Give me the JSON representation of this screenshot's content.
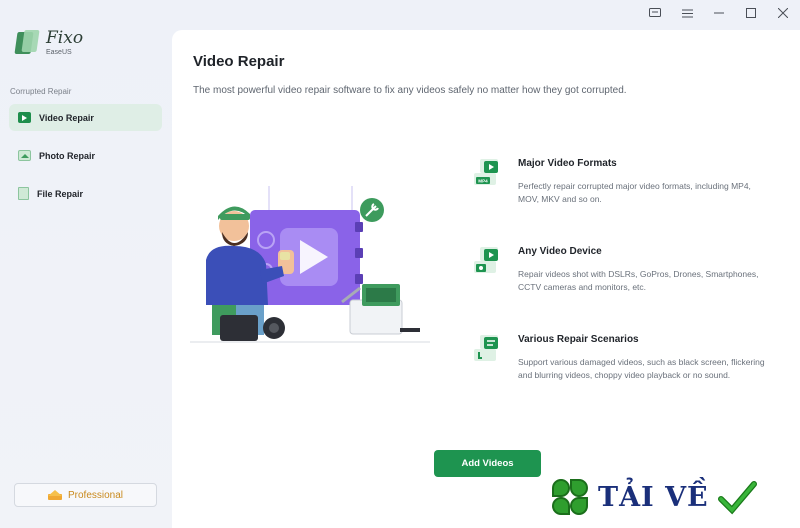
{
  "window": {
    "controls": [
      "feedback-icon",
      "menu-icon",
      "minimize-icon",
      "maximize-icon",
      "close-icon"
    ]
  },
  "app": {
    "name": "Fixo",
    "sub": "EaseUS"
  },
  "sidebar": {
    "section_label": "Corrupted Repair",
    "items": [
      {
        "label": "Video Repair",
        "icon": "video-icon",
        "active": true
      },
      {
        "label": "Photo Repair",
        "icon": "photo-icon",
        "active": false
      },
      {
        "label": "File Repair",
        "icon": "file-icon",
        "active": false
      }
    ],
    "pro_label": "Professional"
  },
  "main": {
    "title": "Video Repair",
    "subtitle": "The most powerful video repair software to fix any videos safely no matter how they got corrupted.",
    "features": [
      {
        "title": "Major Video Formats",
        "desc": "Perfectly repair corrupted major video formats, including MP4, MOV, MKV and so on.",
        "icon": "video-format-icon",
        "badge": "MP4"
      },
      {
        "title": "Any Video Device",
        "desc": "Repair videos shot with DSLRs, GoPros, Drones, Smartphones, CCTV cameras and monitors, etc.",
        "icon": "video-device-icon"
      },
      {
        "title": "Various Repair Scenarios",
        "desc": "Support various damaged videos, such as black screen, flickering and blurring videos, choppy video playback or no sound.",
        "icon": "repair-scenario-icon"
      }
    ],
    "add_button": "Add Videos"
  },
  "watermark": {
    "text": "TẢI VỀ"
  },
  "colors": {
    "accent": "#1e9450",
    "nav_active_bg": "#dfeee6",
    "illustration_purple": "#8a63e8",
    "watermark_text": "#1a2f7a"
  }
}
